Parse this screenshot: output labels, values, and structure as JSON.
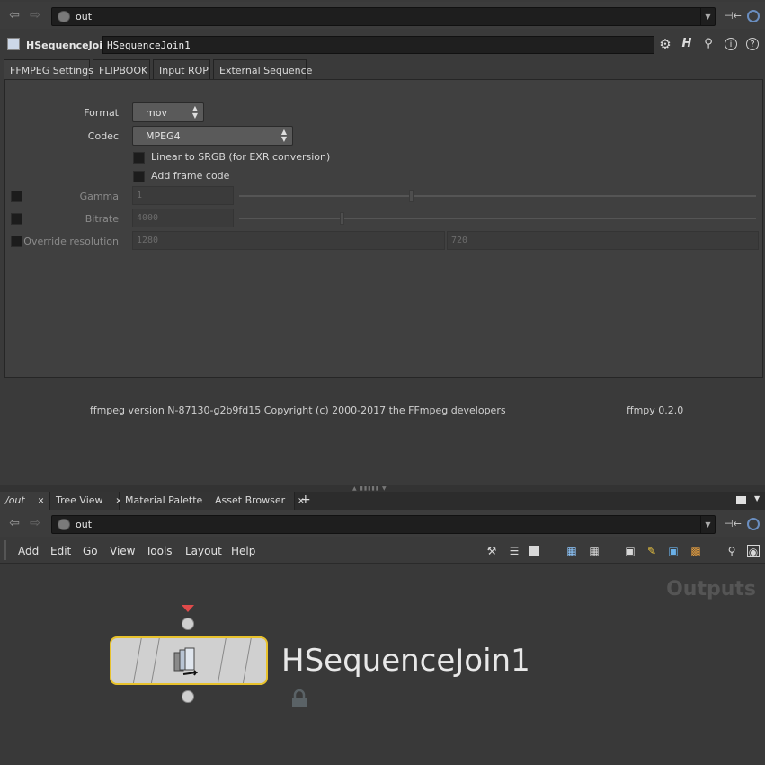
{
  "top_path": {
    "path": "out"
  },
  "node": {
    "type_label": "HSequenceJoin",
    "name": "HSequenceJoin1"
  },
  "tabs": [
    "FFMPEG Settings",
    "FLIPBOOK",
    "Input ROP",
    "External Sequence"
  ],
  "params": {
    "format": {
      "label": "Format",
      "value": "mov"
    },
    "codec": {
      "label": "Codec",
      "value": "MPEG4"
    },
    "linear": {
      "label": "Linear to SRGB (for EXR conversion)"
    },
    "frame_code": {
      "label": "Add frame code"
    },
    "gamma": {
      "label": "Gamma",
      "value": "1"
    },
    "bitrate": {
      "label": "Bitrate",
      "value": "4000"
    },
    "override": {
      "label": "Override resolution",
      "x": "1280",
      "y": "720"
    }
  },
  "footer": {
    "copyright": "ffmpeg version N-87130-g2b9fd15 Copyright (c) 2000-2017 the FFmpeg developers",
    "version": "ffmpy 0.2.0"
  },
  "pane_tabs": [
    "/out",
    "Tree View",
    "Material Palette",
    "Asset Browser"
  ],
  "network_path": {
    "path": "out"
  },
  "menubar": [
    "Add",
    "Edit",
    "Go",
    "View",
    "Tools",
    "Layout",
    "Help"
  ],
  "network": {
    "context_label": "Outputs",
    "node_label": "HSequenceJoin1"
  },
  "colors": {
    "selection": "#e8c22c",
    "display_flag": "#e04a4a",
    "accent": "#6a8ec0"
  }
}
